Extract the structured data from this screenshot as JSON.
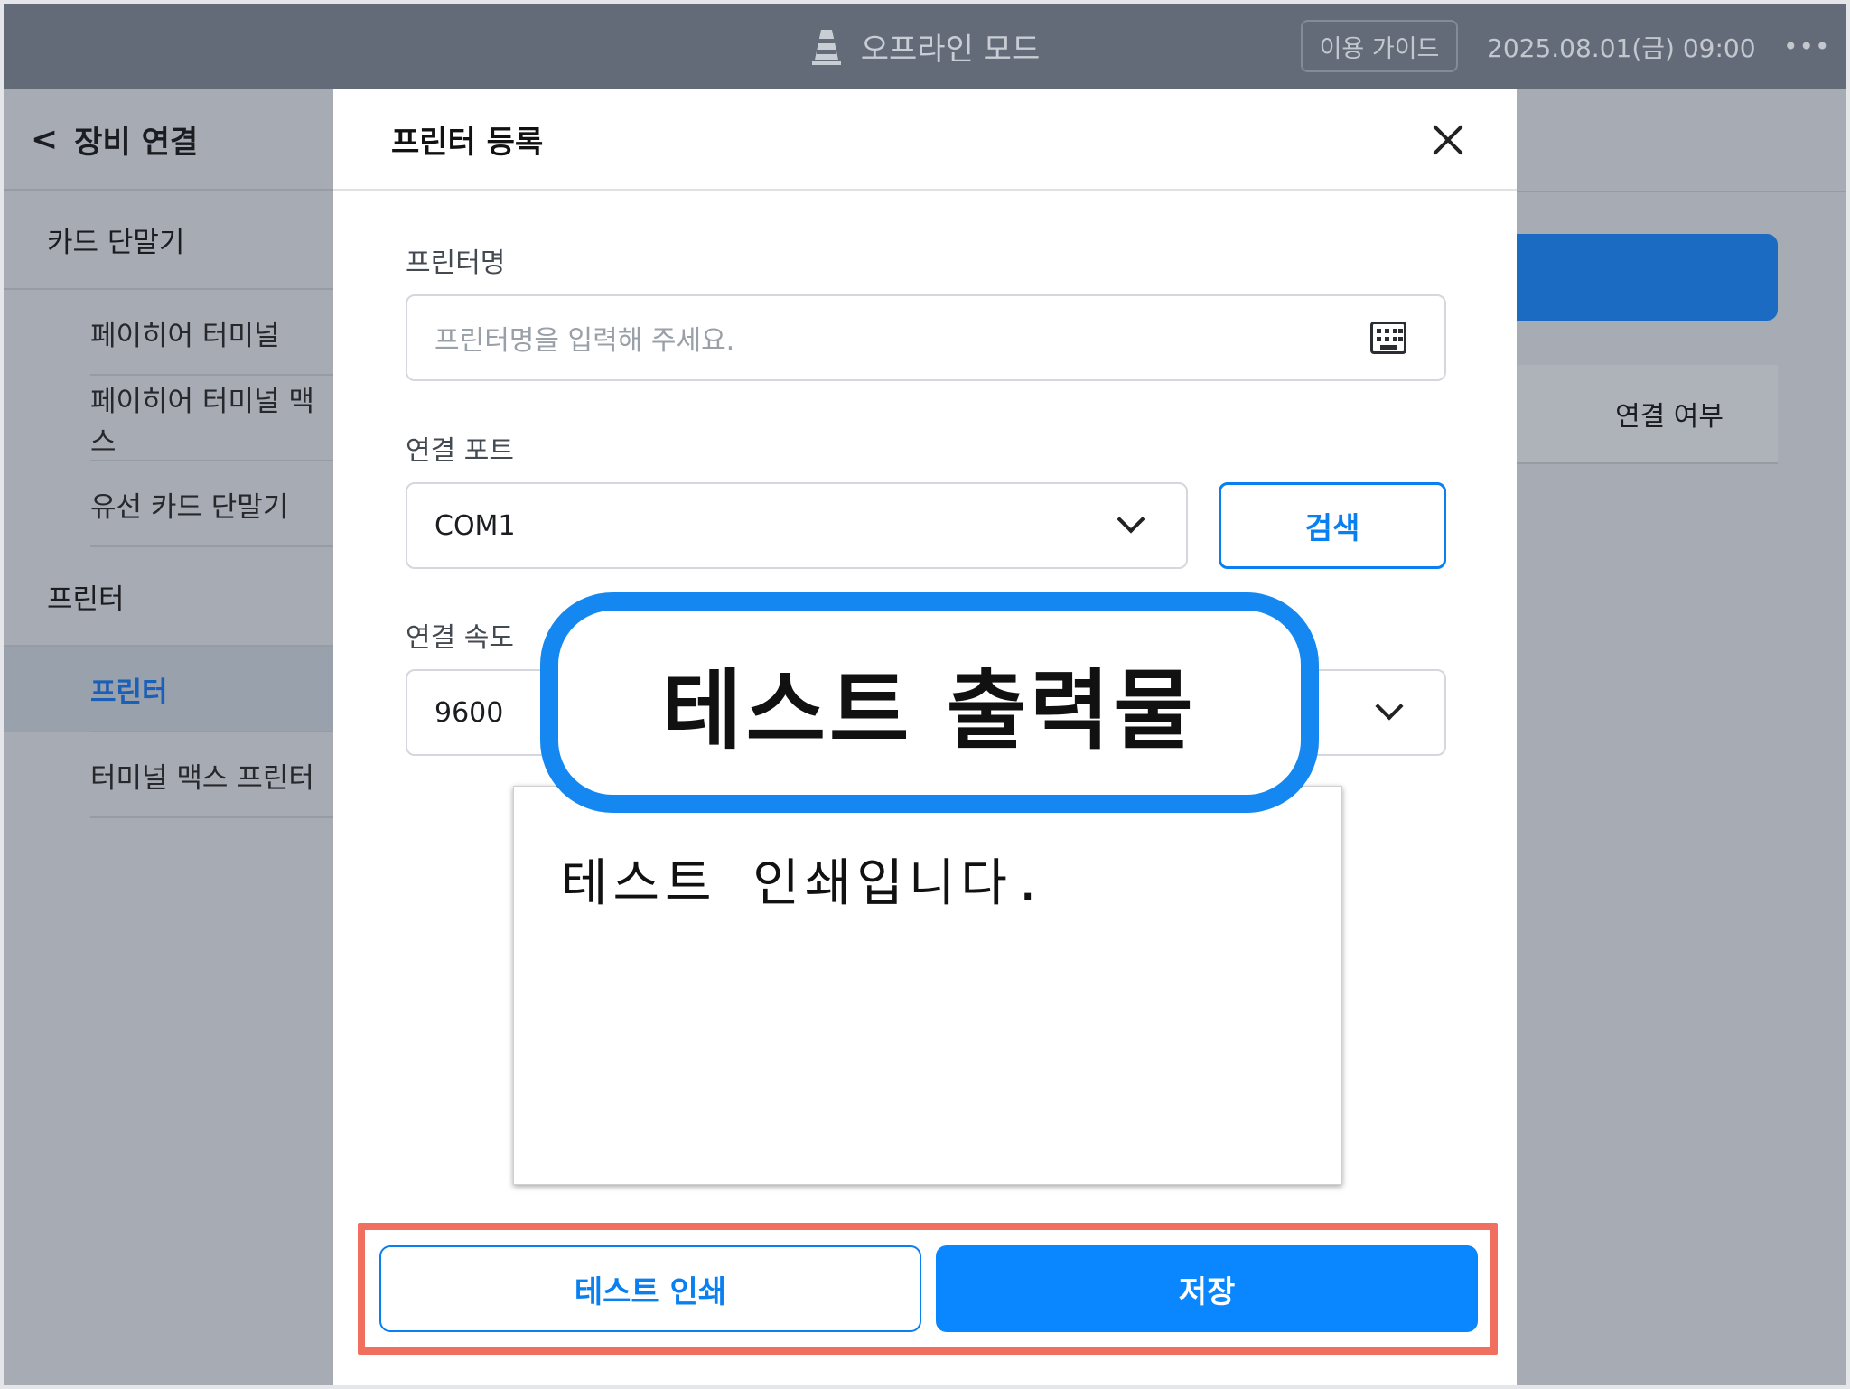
{
  "topbar": {
    "mode_label": "오프라인 모드",
    "guide_label": "이용 가이드",
    "datetime": "2025.08.01(금) 09:00",
    "more_label": "•••"
  },
  "sidebar": {
    "title": "장비 연결",
    "back_label": "<",
    "groups": [
      {
        "label": "카드 단말기",
        "items": [
          "페이히어 터미널",
          "페이히어 터미널 맥스",
          "유선 카드 단말기"
        ]
      },
      {
        "label": "프린터",
        "items": [
          "프린터",
          "터미널 맥스 프린터"
        ]
      }
    ],
    "active_item": "프린터"
  },
  "background": {
    "connection_status_label": "연결 여부"
  },
  "modal": {
    "title": "프린터 등록",
    "printer_name": {
      "label": "프린터명",
      "placeholder": "프린터명을 입력해 주세요.",
      "value": ""
    },
    "port": {
      "label": "연결 포트",
      "value": "COM1"
    },
    "search_label": "검색",
    "speed": {
      "label": "연결 속도",
      "value": "9600"
    },
    "test_print_label": "테스트 인쇄",
    "save_label": "저장"
  },
  "preview": {
    "callout_title": "테스트 출력물",
    "print_text": "테스트 인쇄입니다."
  },
  "colors": {
    "accent": "#0a87ff",
    "callout_border": "#1487f0",
    "highlight": "#f06f5e",
    "topbar": "#646b78"
  }
}
